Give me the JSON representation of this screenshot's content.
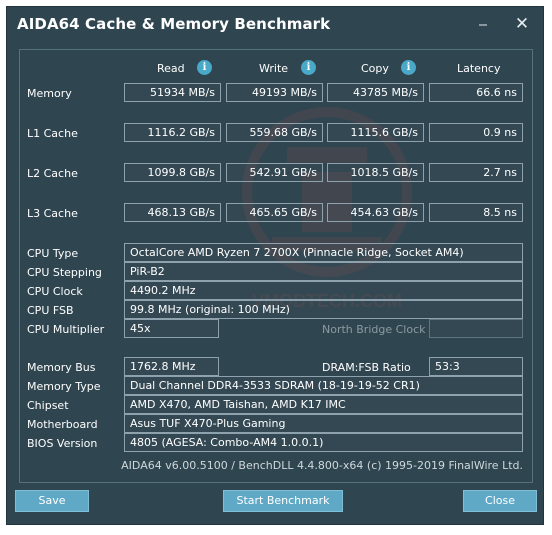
{
  "window": {
    "title": "AIDA64 Cache & Memory Benchmark",
    "min_glyph": "⎯",
    "close_glyph": "✕"
  },
  "columns": {
    "read": "Read",
    "write": "Write",
    "copy": "Copy",
    "latency": "Latency",
    "info_glyph": "i"
  },
  "rows": [
    {
      "label": "Memory",
      "read": "51934 MB/s",
      "write": "49193 MB/s",
      "copy": "43785 MB/s",
      "latency": "66.6 ns"
    },
    {
      "label": "L1 Cache",
      "read": "1116.2 GB/s",
      "write": "559.68 GB/s",
      "copy": "1115.6 GB/s",
      "latency": "0.9 ns"
    },
    {
      "label": "L2 Cache",
      "read": "1099.8 GB/s",
      "write": "542.91 GB/s",
      "copy": "1018.5 GB/s",
      "latency": "2.7 ns"
    },
    {
      "label": "L3 Cache",
      "read": "468.13 GB/s",
      "write": "465.65 GB/s",
      "copy": "454.63 GB/s",
      "latency": "8.5 ns"
    }
  ],
  "cpu": {
    "type_label": "CPU Type",
    "type": "OctalCore AMD Ryzen 7 2700X  (Pinnacle Ridge, Socket AM4)",
    "stepping_label": "CPU Stepping",
    "stepping": "PiR-B2",
    "clock_label": "CPU Clock",
    "clock": "4490.2 MHz",
    "fsb_label": "CPU FSB",
    "fsb": "99.8 MHz  (original: 100 MHz)",
    "multiplier_label": "CPU Multiplier",
    "multiplier": "45x",
    "north_bridge_label": "North Bridge Clock"
  },
  "system": {
    "membus_label": "Memory Bus",
    "membus": "1762.8 MHz",
    "dram_ratio_label": "DRAM:FSB Ratio",
    "dram_ratio": "53:3",
    "memtype_label": "Memory Type",
    "memtype": "Dual Channel DDR4-3533 SDRAM  (18-19-19-52 CR1)",
    "chipset_label": "Chipset",
    "chipset": "AMD X470, AMD Taishan, AMD K17 IMC",
    "motherboard_label": "Motherboard",
    "motherboard": "Asus TUF X470-Plus Gaming",
    "bios_label": "BIOS Version",
    "bios": "4805  (AGESA: Combo-AM4 1.0.0.1)"
  },
  "footer": "AIDA64 v6.00.5100 / BenchDLL 4.4.800-x64  (c) 1995-2019 FinalWire Ltd.",
  "buttons": {
    "save": "Save",
    "start": "Start Benchmark",
    "close": "Close"
  },
  "watermark": "VMODTECH.COM",
  "colors": {
    "background": "#2f4550",
    "accent": "#5fa9c7",
    "info": "#4aa8c9",
    "border": "#8da2ac"
  }
}
